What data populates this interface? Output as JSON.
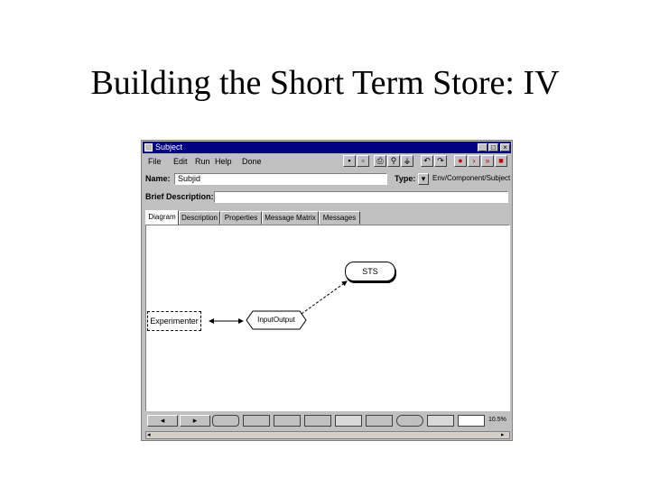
{
  "slide": {
    "title": "Building the Short Term Store: IV"
  },
  "window": {
    "title": "Subject",
    "menu": [
      "File",
      "Edit",
      "Run",
      "Help",
      "Done"
    ],
    "name_label": "Name:",
    "name_value": "Subjid",
    "type_label": "Type:",
    "type_value": "Env/Component/Subject",
    "brief_label": "Brief Description:",
    "brief_value": ""
  },
  "tabs": [
    "Diagram",
    "Description",
    "Properties",
    "Message Matrix",
    "Messages"
  ],
  "diagram": {
    "nodes": {
      "experimenter": "Experimenter",
      "inputoutput": "InputOutput",
      "sts": "STS"
    }
  },
  "palette": {
    "zoom": "10.5%"
  }
}
